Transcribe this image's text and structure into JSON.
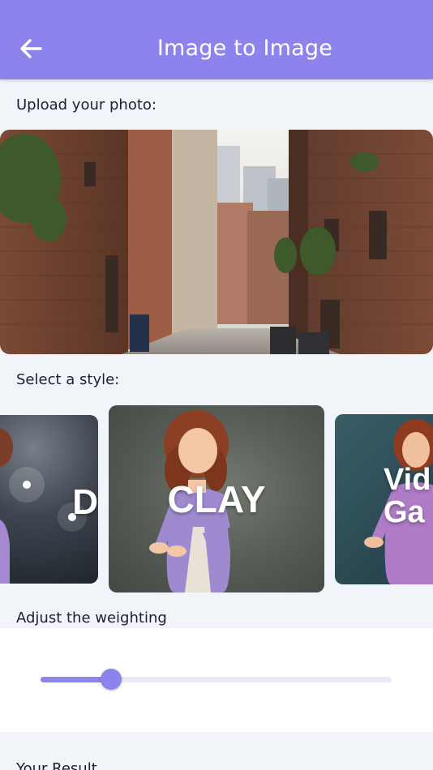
{
  "app_bar": {
    "title": "Image to Image",
    "back_icon": "arrow-left-icon",
    "background": "#8c84ec"
  },
  "upload": {
    "label": "Upload your photo:"
  },
  "style": {
    "label": "Select a style:",
    "cards": [
      {
        "name": "D"
      },
      {
        "name": "CLAY"
      },
      {
        "name": "Vid\nGa"
      }
    ]
  },
  "weighting": {
    "label": "Adjust the weighting",
    "value_fraction": 0.2
  },
  "result": {
    "label": "Your Result"
  },
  "colors": {
    "accent": "#8c84ec",
    "background": "#f1f4f8"
  }
}
